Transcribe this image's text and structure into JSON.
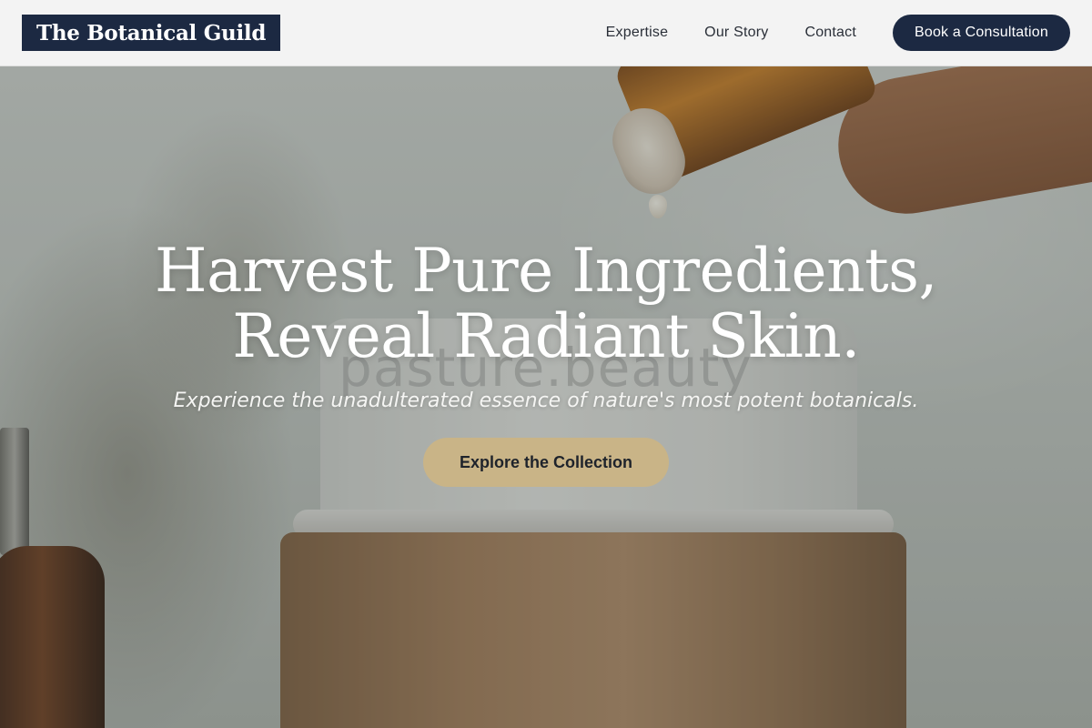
{
  "header": {
    "logo_text": "The Botanical Guild",
    "nav": [
      {
        "label": "Expertise"
      },
      {
        "label": "Our Story"
      },
      {
        "label": "Contact"
      }
    ],
    "cta_label": "Book a Consultation"
  },
  "hero": {
    "title_line1": "Harvest Pure Ingredients,",
    "title_line2": "Reveal Radiant Skin.",
    "subtitle": "Experience the unadulterated essence of nature's most potent botanicals.",
    "button_label": "Explore the Collection",
    "image_jar_text": "pasture.beauty"
  },
  "colors": {
    "brand_navy": "#1c2942",
    "accent_gold": "#c9b487",
    "header_bg": "#f3f3f3"
  }
}
